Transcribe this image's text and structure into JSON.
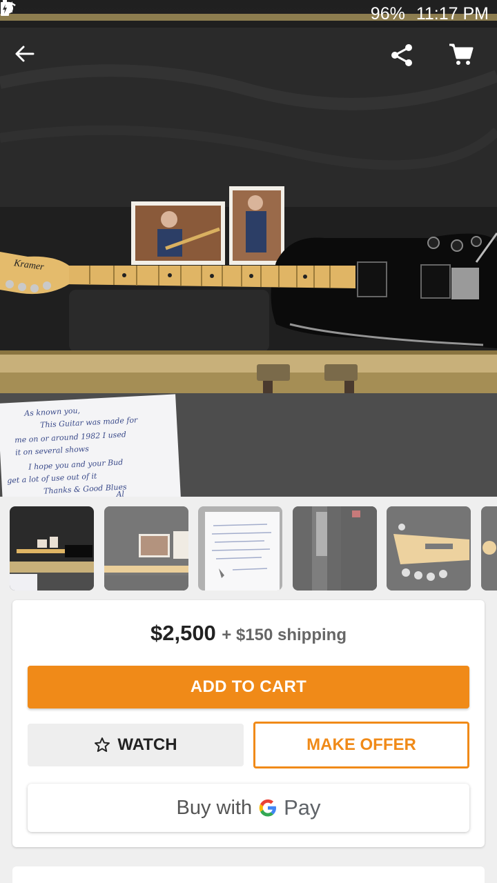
{
  "status_bar": {
    "battery": "96%",
    "time": "11:17 PM",
    "icons": [
      "alarm-icon",
      "wifi-icon",
      "signal-icon",
      "battery-charging-icon"
    ]
  },
  "toolbar": {
    "back_icon": "arrow-left-icon",
    "share_icon": "share-icon",
    "cart_icon": "cart-icon"
  },
  "photo_note_lines": [
    "As known you,",
    "This Guitar was made for",
    "me on or around 1982 I used",
    "it on several shows",
    "I hope you and your Bud",
    "get a lot of use out of it",
    "Thanks & Good Blues",
    "Al"
  ],
  "headstock_brand": "Kramer",
  "thumbnails": [
    {
      "name": "thumb-guitar-case",
      "selected": true
    },
    {
      "name": "thumb-guitar-photos",
      "selected": false
    },
    {
      "name": "thumb-handwritten-note",
      "selected": false
    },
    {
      "name": "thumb-guitar-body",
      "selected": false
    },
    {
      "name": "thumb-headstock",
      "selected": false
    },
    {
      "name": "thumb-partial",
      "selected": false
    }
  ],
  "purchase": {
    "price": "$2,500",
    "shipping": "+ $150 shipping",
    "add_to_cart": "ADD TO CART",
    "watch": "WATCH",
    "make_offer": "MAKE OFFER",
    "buy_with": "Buy with",
    "pay": "Pay",
    "gpay_g": "G",
    "colors": {
      "accent": "#f08a18",
      "watch_bg": "#eeeeee"
    }
  }
}
